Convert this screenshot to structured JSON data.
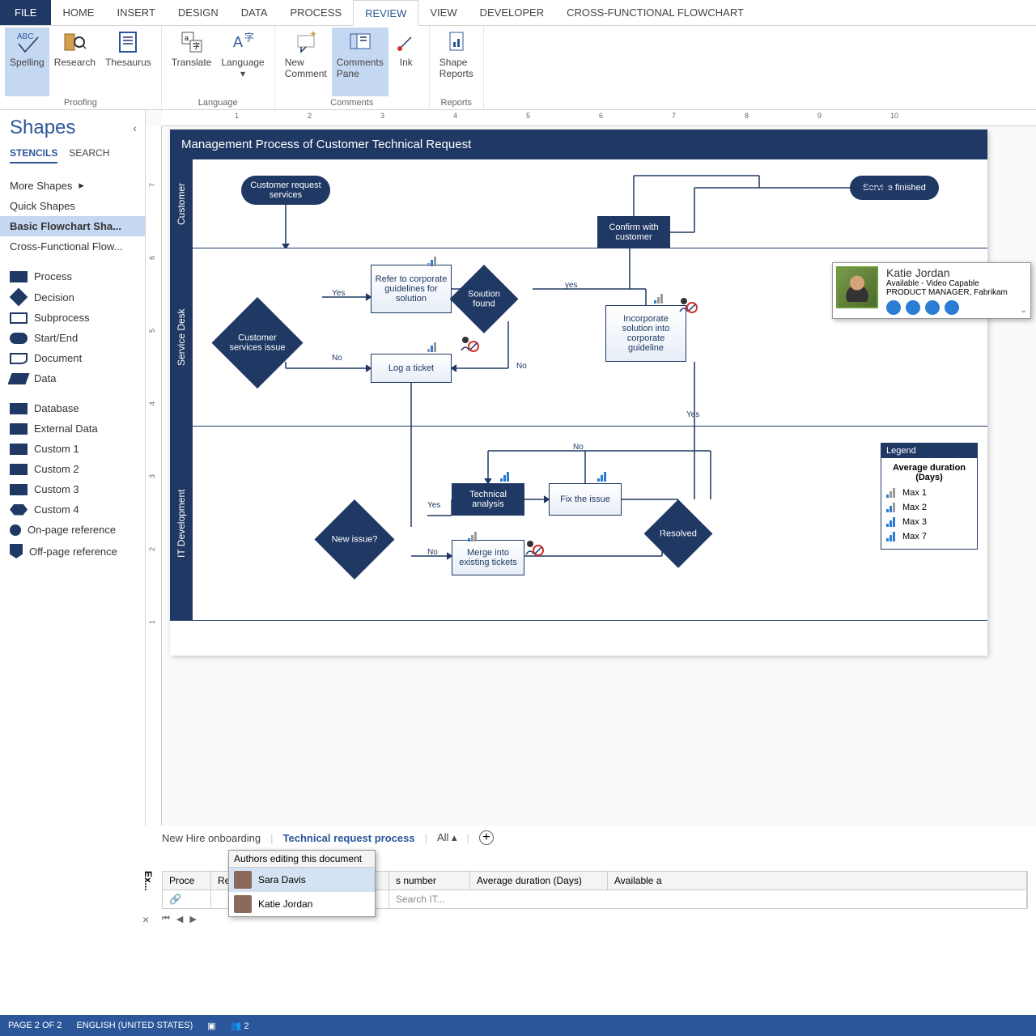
{
  "ribbon": {
    "tabs": [
      "FILE",
      "HOME",
      "INSERT",
      "DESIGN",
      "DATA",
      "PROCESS",
      "REVIEW",
      "VIEW",
      "DEVELOPER",
      "CROSS-FUNCTIONAL FLOWCHART"
    ],
    "active": "REVIEW",
    "groups": {
      "proofing": {
        "label": "Proofing",
        "spelling": "Spelling",
        "research": "Research",
        "thesaurus": "Thesaurus"
      },
      "language": {
        "label": "Language",
        "translate": "Translate",
        "language": "Language"
      },
      "comments": {
        "label": "Comments",
        "new": "New\nComment",
        "pane": "Comments\nPane",
        "ink": "Ink"
      },
      "reports": {
        "label": "Reports",
        "shape": "Shape\nReports"
      }
    }
  },
  "shapes": {
    "title": "Shapes",
    "tabs": [
      "STENCILS",
      "SEARCH"
    ],
    "more": "More Shapes",
    "quick": "Quick Shapes",
    "basic": "Basic Flowchart Sha...",
    "cross": "Cross-Functional Flow...",
    "items": [
      "Process",
      "Decision",
      "Subprocess",
      "Start/End",
      "Document",
      "Data",
      "Database",
      "External Data",
      "Custom 1",
      "Custom 2",
      "Custom 3",
      "Custom 4",
      "On-page reference",
      "Off-page reference"
    ]
  },
  "diagram": {
    "title": "Management Process of Customer Technical Request",
    "lanes": [
      "Customer",
      "Service Desk",
      "IT Development"
    ],
    "nodes": {
      "start": "Customer request services",
      "finish": "Service finished",
      "issue": "Customer services issue",
      "refer": "Refer to corporate guidelines for solution",
      "log": "Log a ticket",
      "solution": "Solution found",
      "confirm": "Confirm with customer",
      "incorporate": "Incorporate solution into corporate guideline",
      "newissue": "New issue?",
      "technical": "Technical analysis",
      "fix": "Fix the issue",
      "merge": "Merge into existing tickets",
      "resolved": "Resolved"
    },
    "labels": {
      "yes": "Yes",
      "no": "No",
      "yes2": "yes"
    },
    "legend": {
      "title": "Legend",
      "subtitle": "Average duration (Days)",
      "items": [
        "Max 1",
        "Max 2",
        "Max 3",
        "Max 7"
      ]
    }
  },
  "contact": {
    "name": "Katie Jordan",
    "status": "Available - Video Capable",
    "role": "PRODUCT MANAGER, Fabrikam"
  },
  "pages": {
    "p1": "New Hire onboarding",
    "p2": "Technical request process",
    "all": "All"
  },
  "authors": {
    "title": "Authors editing this document",
    "a1": "Sara Davis",
    "a2": "Katie Jordan"
  },
  "extdata": {
    "vert": "Ex...",
    "c1": "Proce",
    "c2": "Refer",
    "c3": "s number",
    "c4": "Average duration (Days)",
    "c5": "Available a",
    "search": "Search IT..."
  },
  "status": {
    "page": "PAGE 2 OF 2",
    "lang": "ENGLISH (UNITED STATES)",
    "users": "2"
  },
  "ruler_h": [
    "1",
    "2",
    "3",
    "4",
    "5",
    "6",
    "7",
    "8",
    "9",
    "10"
  ],
  "ruler_v": [
    "7",
    "6",
    "5",
    "4",
    "3",
    "2",
    "1"
  ]
}
